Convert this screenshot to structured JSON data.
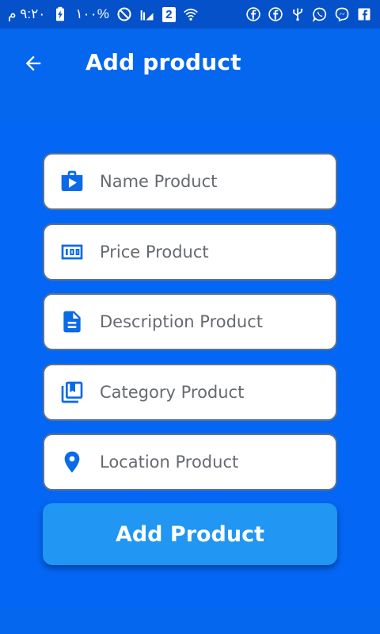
{
  "status_bar": {
    "time": "٩:٢٠ م",
    "battery": "%١٠٠",
    "sim_badge": "2",
    "left_icons": [
      "battery-charging-icon",
      "do-not-disturb-icon",
      "signal-icon",
      "sim-icon",
      "wifi-icon"
    ],
    "right_icons": [
      "facebook-icon",
      "facebook-icon",
      "usb-icon",
      "whatsapp-icon",
      "messenger-icon",
      "facebook-square-icon"
    ]
  },
  "app_bar": {
    "title": "Add product",
    "back_icon": "arrow-back-icon"
  },
  "form": {
    "fields": [
      {
        "name": "name",
        "placeholder": "Name Product",
        "icon": "shop-bag-icon"
      },
      {
        "name": "price",
        "placeholder": "Price Product",
        "icon": "money-icon"
      },
      {
        "name": "description",
        "placeholder": "Description Product",
        "icon": "document-icon"
      },
      {
        "name": "category",
        "placeholder": "Category Product",
        "icon": "library-books-icon"
      },
      {
        "name": "location",
        "placeholder": "Location Product",
        "icon": "location-pin-icon"
      }
    ],
    "submit_label": "Add Product"
  },
  "colors": {
    "primary": "#0566ee",
    "status_bar": "#0451c9",
    "button": "#2196f3",
    "icon": "#0a6ae8",
    "field_border": "#5f7488"
  }
}
